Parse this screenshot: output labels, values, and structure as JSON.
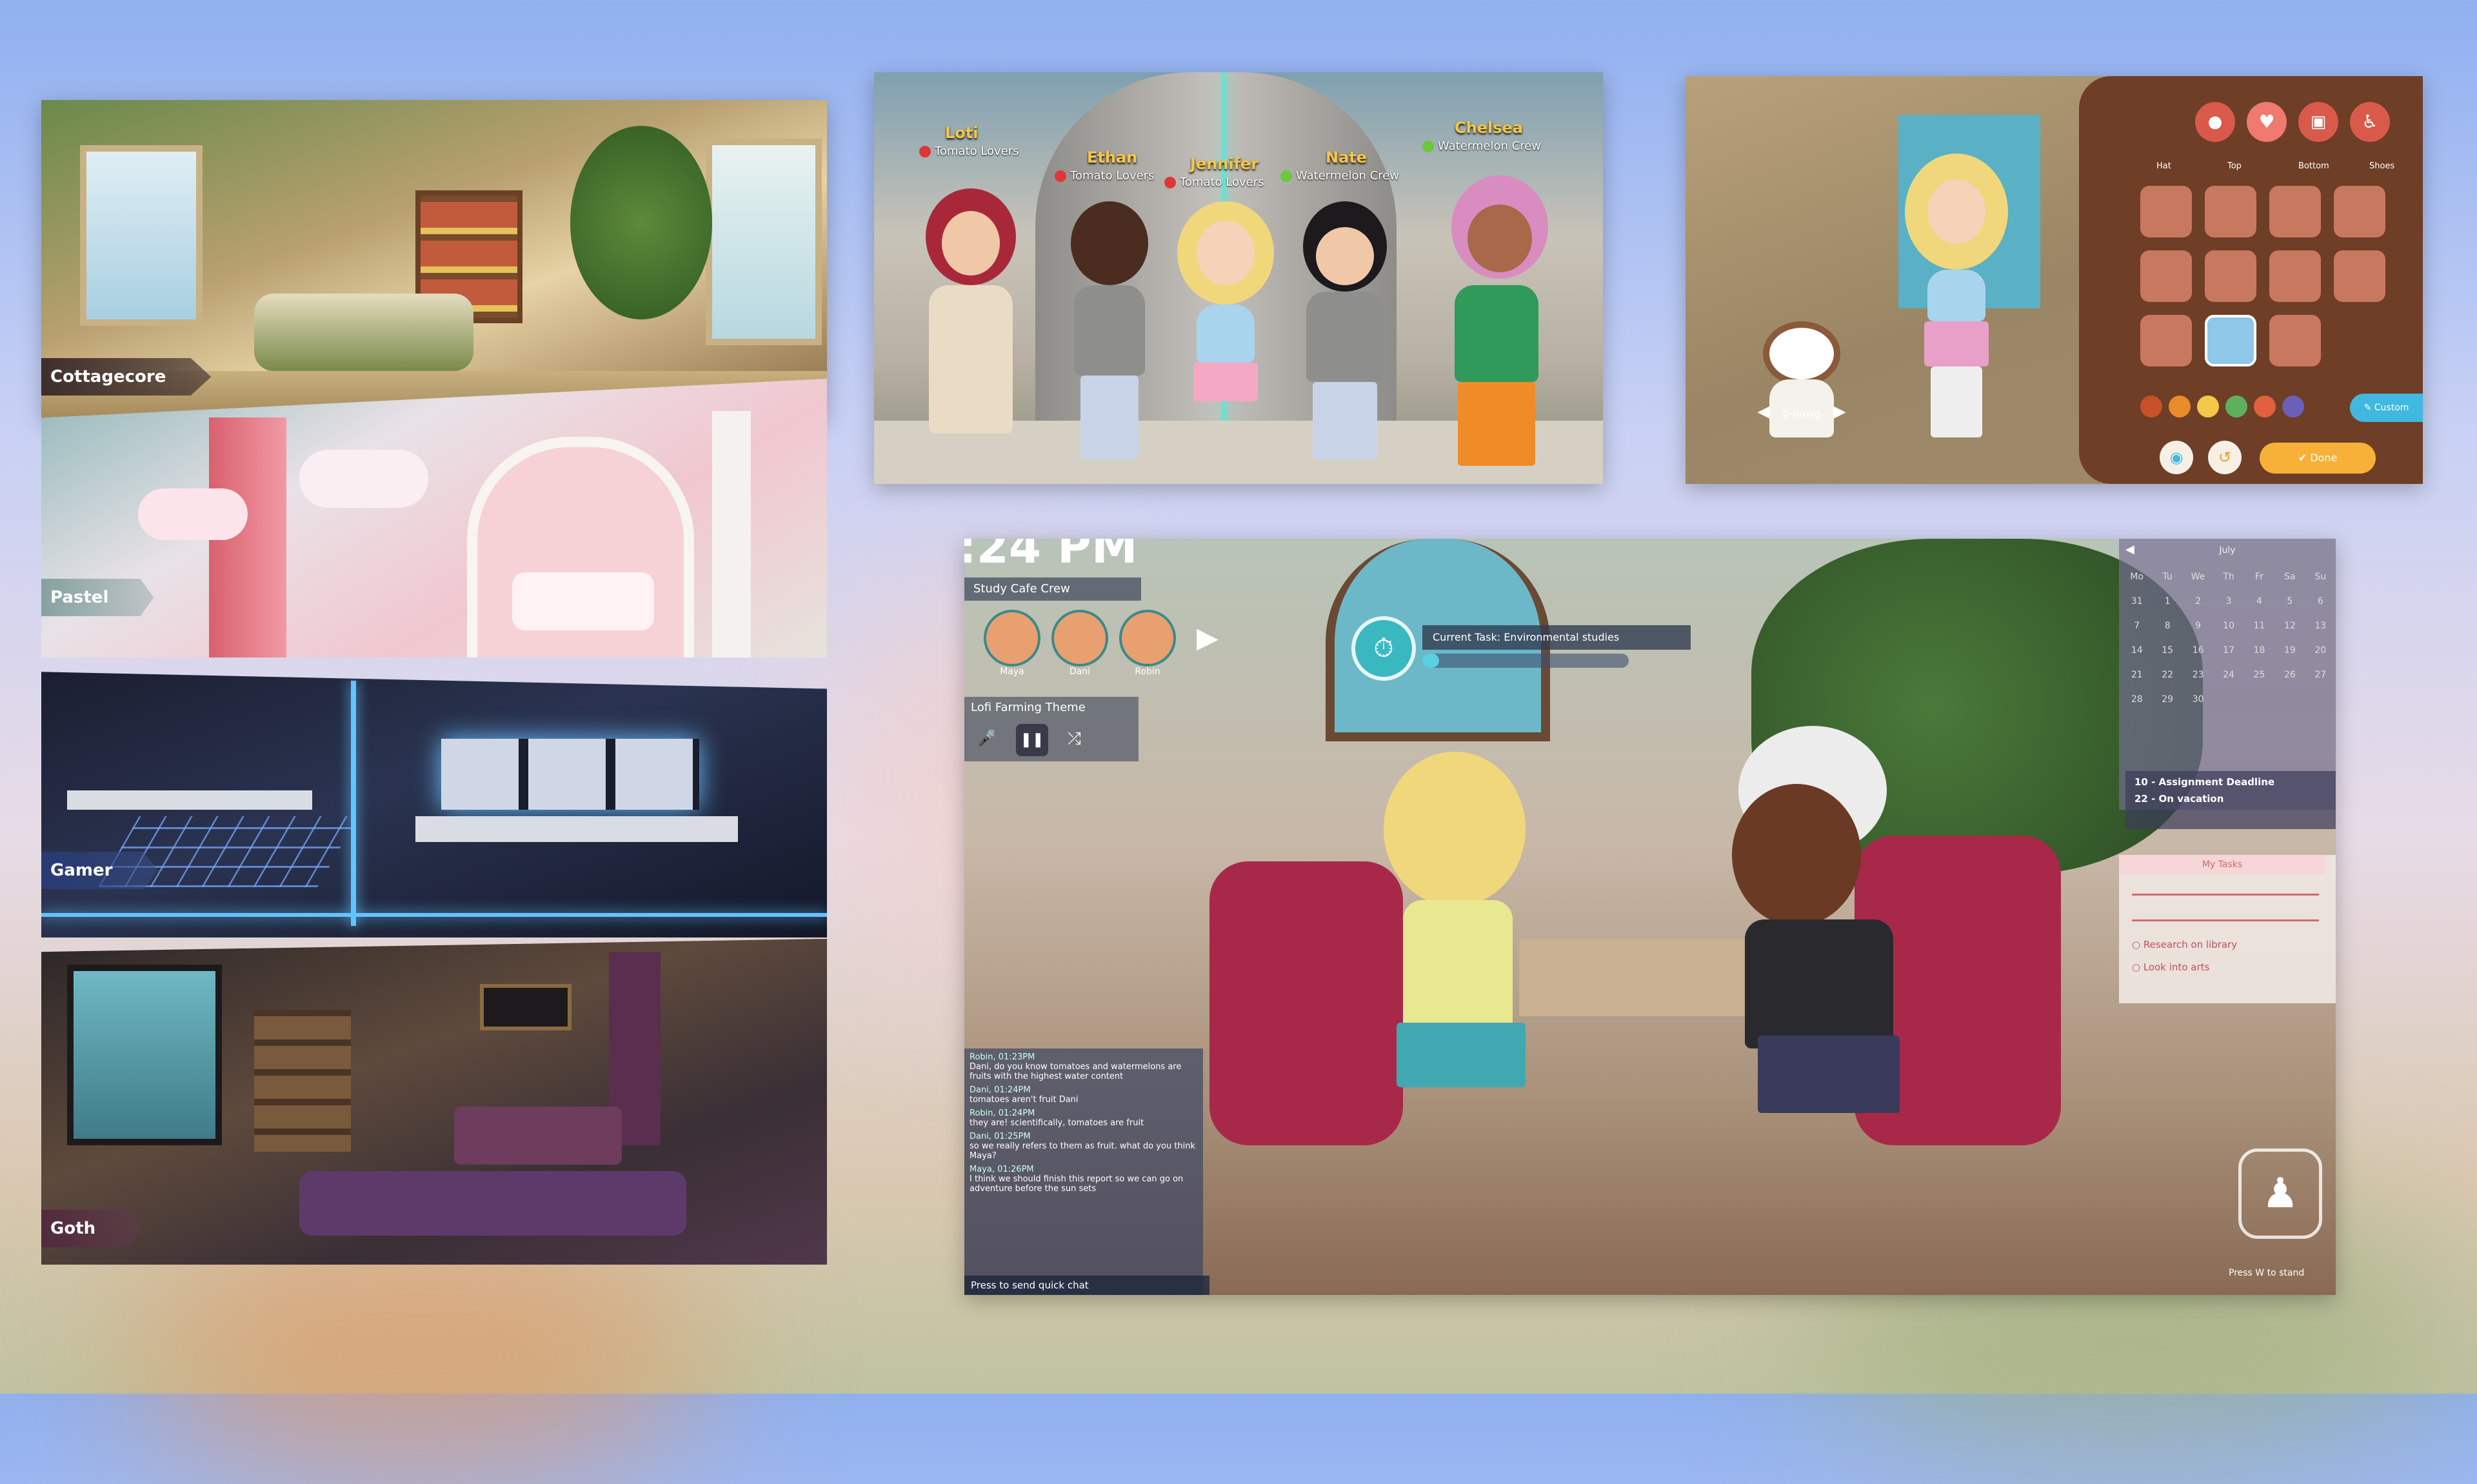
{
  "rooms": {
    "cottagecore": "Cottagecore",
    "pastel": "Pastel",
    "gamer": "Gamer",
    "goth": "Goth"
  },
  "group": {
    "members": [
      {
        "name": "Loti",
        "team": "Tomato Lovers",
        "team_color": "#e0363b"
      },
      {
        "name": "Ethan",
        "team": "Tomato Lovers",
        "team_color": "#e0363b"
      },
      {
        "name": "Jennifer",
        "team": "Tomato Lovers",
        "team_color": "#e0363b"
      },
      {
        "name": "Nate",
        "team": "Watermelon Crew",
        "team_color": "#6cc83b"
      },
      {
        "name": "Chelsea",
        "team": "Watermelon Crew",
        "team_color": "#6cc83b"
      }
    ]
  },
  "customizer": {
    "tabs": [
      "Hat",
      "Top",
      "Bottom",
      "Shoes"
    ],
    "pet_name": "p-dawg",
    "custom_label": "Custom",
    "done_label": "Done",
    "swatches": [
      "#c8502a",
      "#e88c28",
      "#f3c84a",
      "#5fb05c",
      "#e06040",
      "#6a60b8"
    ]
  },
  "cafe": {
    "clock": ":24 PM",
    "crew_label": "Study Cafe Crew",
    "avatars": [
      "Maya",
      "Dani",
      "Robin"
    ],
    "task_label": "Current Task: Environmental studies",
    "music_label": "Lofi Farming Theme",
    "calendar_month": "July",
    "weekdays": [
      "Mo",
      "Tu",
      "We",
      "Th",
      "Fr",
      "Sa",
      "Su"
    ],
    "weeks": [
      [
        "31",
        "1",
        "2",
        "3",
        "4",
        "5",
        "6"
      ],
      [
        "7",
        "8",
        "9",
        "10",
        "11",
        "12",
        "13"
      ],
      [
        "14",
        "15",
        "16",
        "17",
        "18",
        "19",
        "20"
      ],
      [
        "21",
        "22",
        "23",
        "24",
        "25",
        "26",
        "27"
      ],
      [
        "28",
        "29",
        "30",
        "",
        "",
        "",
        ""
      ]
    ],
    "events": [
      "10 - Assignment Deadline",
      "22 - On vacation"
    ],
    "tasks_title": "My Tasks",
    "tasks": [
      "Research on library",
      "Look into arts"
    ],
    "chat": [
      {
        "time": "Robin, 01:23PM",
        "text": "Dani, do you know tomatoes and watermelons are fruits with the highest water content"
      },
      {
        "time": "Dani, 01:24PM",
        "text": "tomatoes aren't fruit Dani"
      },
      {
        "time": "Robin, 01:24PM",
        "text": "they are! scientifically, tomatoes are fruit"
      },
      {
        "time": "Dani, 01:25PM",
        "text": "so we really refers to them as fruit. what do you think Maya?"
      },
      {
        "time": "Maya, 01:26PM",
        "text": "I think we should finish this report so we can go on adventure before the sun sets"
      }
    ],
    "chat_hint": "to send quick chat",
    "chat_key": "Press",
    "stand_hint": "Press W to stand"
  }
}
